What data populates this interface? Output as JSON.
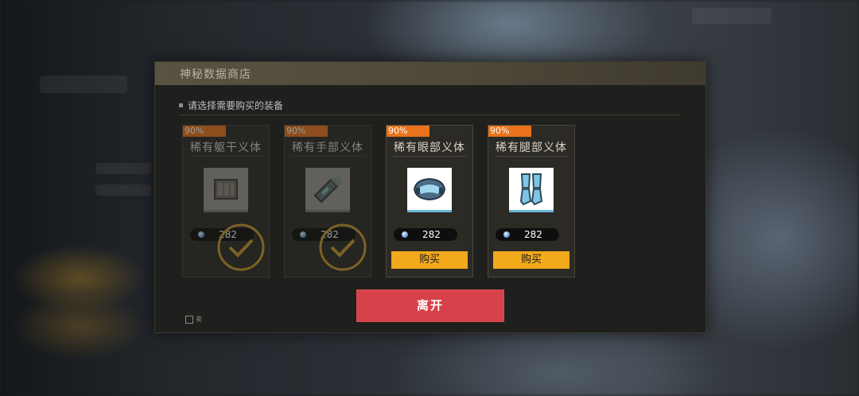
{
  "dialog": {
    "title": "神秘数据商店",
    "prompt": "请选择需要购买的装备",
    "leave_label": "离开",
    "logo_text": "瓷"
  },
  "items": [
    {
      "name": "稀有躯干义体",
      "discount": "90%",
      "price": "282",
      "state": "sold",
      "icon": "torso-armor-icon"
    },
    {
      "name": "稀有手部义体",
      "discount": "90%",
      "price": "282",
      "state": "sold",
      "icon": "arm-gauntlet-icon"
    },
    {
      "name": "稀有眼部义体",
      "discount": "90%",
      "price": "282",
      "state": "available",
      "icon": "eye-visor-icon",
      "buy_label": "购买"
    },
    {
      "name": "稀有腿部义体",
      "discount": "90%",
      "price": "282",
      "state": "available",
      "icon": "leg-armor-icon",
      "buy_label": "购买"
    }
  ],
  "colors": {
    "discount": "#e8731c",
    "buy_button": "#f3a91c",
    "leave_button": "#d7414a",
    "header": "#5b5341"
  }
}
